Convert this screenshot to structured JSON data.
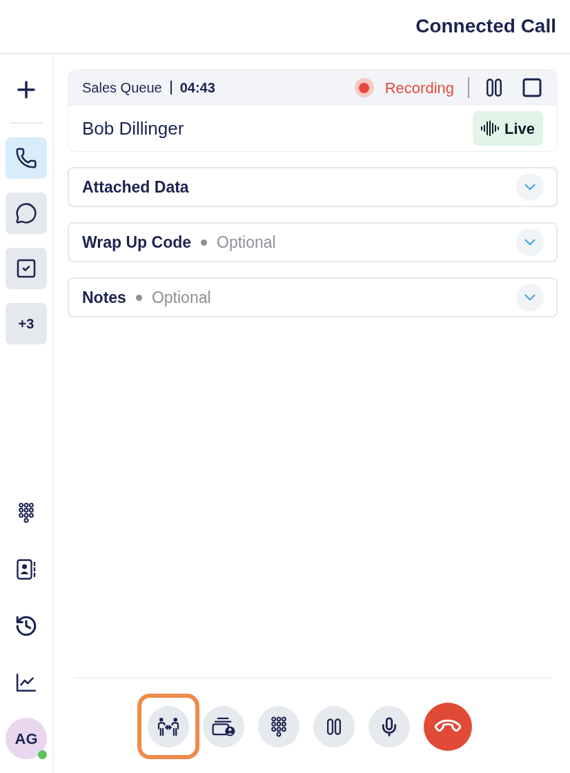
{
  "header": {
    "title": "Connected Call"
  },
  "sidebar": {
    "channels": [
      {
        "kind": "voice",
        "selected": true
      },
      {
        "kind": "chat",
        "selected": false
      },
      {
        "kind": "tasks",
        "selected": false
      },
      {
        "kind": "more",
        "label": "+3",
        "selected": false
      }
    ],
    "tools": [
      {
        "kind": "dialpad"
      },
      {
        "kind": "contacts"
      },
      {
        "kind": "history"
      },
      {
        "kind": "reports"
      }
    ],
    "user": {
      "initials": "AG",
      "online": true
    }
  },
  "call": {
    "queue": "Sales Queue",
    "duration": "04:43",
    "recording": {
      "label": "Recording",
      "paused": false
    },
    "caller": "Bob Dillinger",
    "live": {
      "label": "Live"
    }
  },
  "sections": [
    {
      "title": "Attached Data",
      "expanded": false
    },
    {
      "title": "Wrap Up Code",
      "hint": "Optional",
      "expanded": false
    },
    {
      "title": "Notes",
      "hint": "Optional",
      "expanded": false
    }
  ],
  "controls": [
    {
      "kind": "transfer",
      "highlighted": true
    },
    {
      "kind": "consult",
      "highlighted": false
    },
    {
      "kind": "dialpad",
      "highlighted": false
    },
    {
      "kind": "hold",
      "highlighted": false
    },
    {
      "kind": "mute",
      "highlighted": false
    },
    {
      "kind": "hang_up",
      "highlighted": false
    }
  ]
}
